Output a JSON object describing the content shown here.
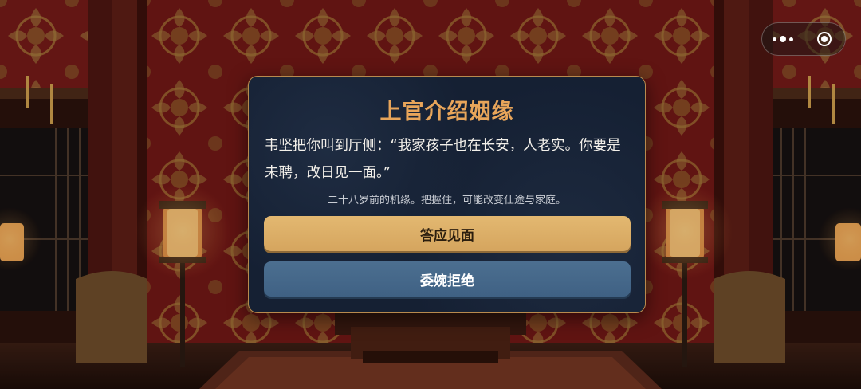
{
  "capsule_menu": {
    "more_icon": "more-dots-icon",
    "close_icon": "target-close-icon"
  },
  "dialog": {
    "title": "上官介绍姻缘",
    "body": "韦坚把你叫到厅侧：“我家孩子也在长安，人老实。你要是未聘，改日见一面。”",
    "hint": "二十八岁前的机缘。把握住，可能改变仕途与家庭。",
    "accept_label": "答应见面",
    "decline_label": "委婉拒绝"
  },
  "colors": {
    "title": "#e8a55a",
    "dialog_bg": "#152033",
    "dialog_border": "#b88a4e",
    "accept_button": "#dcae66",
    "decline_button": "#46698b",
    "wall_red": "#7a1a18"
  }
}
